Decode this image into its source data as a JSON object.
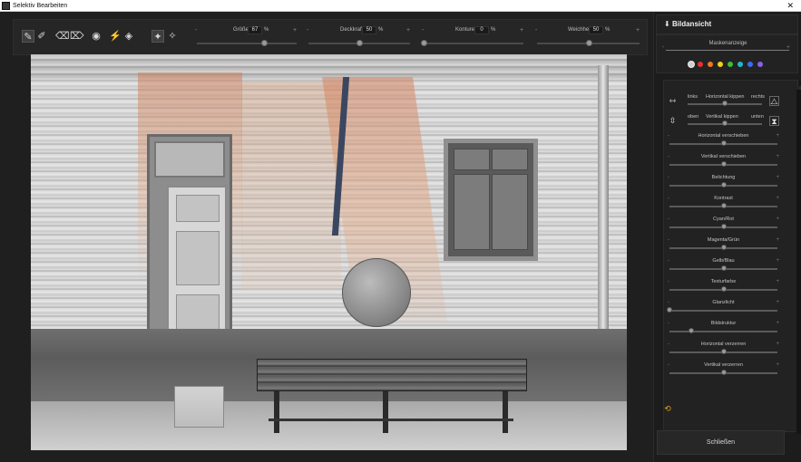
{
  "window": {
    "title": "Selektiv Bearbeiten",
    "close_symbol": "✕"
  },
  "toolbar": {
    "tools": [
      "brush-icon",
      "brush-edit-icon",
      "eraser-icon",
      "eraser-edit-icon",
      "color-picker-icon",
      "wand-icon",
      "fill-icon",
      "mask-view-icon",
      "auto-icon"
    ],
    "sliders": [
      {
        "label": "Größe",
        "value": "67",
        "unit": "%",
        "position": 0.67
      },
      {
        "label": "Deckkraft",
        "value": "50",
        "unit": "%",
        "position": 0.5
      },
      {
        "label": "Konturen",
        "value": "0",
        "unit": "%",
        "position": 0.0
      },
      {
        "label": "Weichheit",
        "value": "50",
        "unit": "%",
        "position": 0.5
      }
    ],
    "minus": "-",
    "plus": "+"
  },
  "right_panel": {
    "header_title": "Bildansicht",
    "header_arrow": "⬇",
    "mask_display": {
      "label": "Maskenanzeige",
      "minus": "-",
      "plus": "+"
    },
    "mask_colors": [
      "#cfcfcf",
      "#e83030",
      "#ef7a1e",
      "#f0d020",
      "#38c038",
      "#20b8c8",
      "#3a6cf0",
      "#8a60e8"
    ],
    "flip": {
      "horizontal": {
        "left": "links",
        "label": "Horizontal kippen",
        "right": "rechts",
        "position": 0.5
      },
      "vertical": {
        "left": "oben",
        "label": "Vertikal kippen",
        "right": "unten",
        "position": 0.5
      }
    },
    "adjustments": [
      {
        "label": "Horizontal verschieben",
        "position": 0.5
      },
      {
        "label": "Vertikal verschieben",
        "position": 0.5
      },
      {
        "label": "Belichtung",
        "position": 0.5
      },
      {
        "label": "Kontrast",
        "position": 0.5
      },
      {
        "label": "Cyan/Rot",
        "position": 0.5
      },
      {
        "label": "Magenta/Grün",
        "position": 0.5
      },
      {
        "label": "Gelb/Blau",
        "position": 0.5
      },
      {
        "label": "Texturfarbe",
        "position": 0.5
      },
      {
        "label": "Glanzlicht",
        "position": 0.0
      },
      {
        "label": "Bildstruktur",
        "position": 0.2
      },
      {
        "label": "Horizontal verzerren",
        "position": 0.5
      },
      {
        "label": "Vertikal verzerren",
        "position": 0.5
      }
    ],
    "minus": "-",
    "plus": "+",
    "reset_icon": "reset-icon",
    "close_label": "Schließen"
  }
}
